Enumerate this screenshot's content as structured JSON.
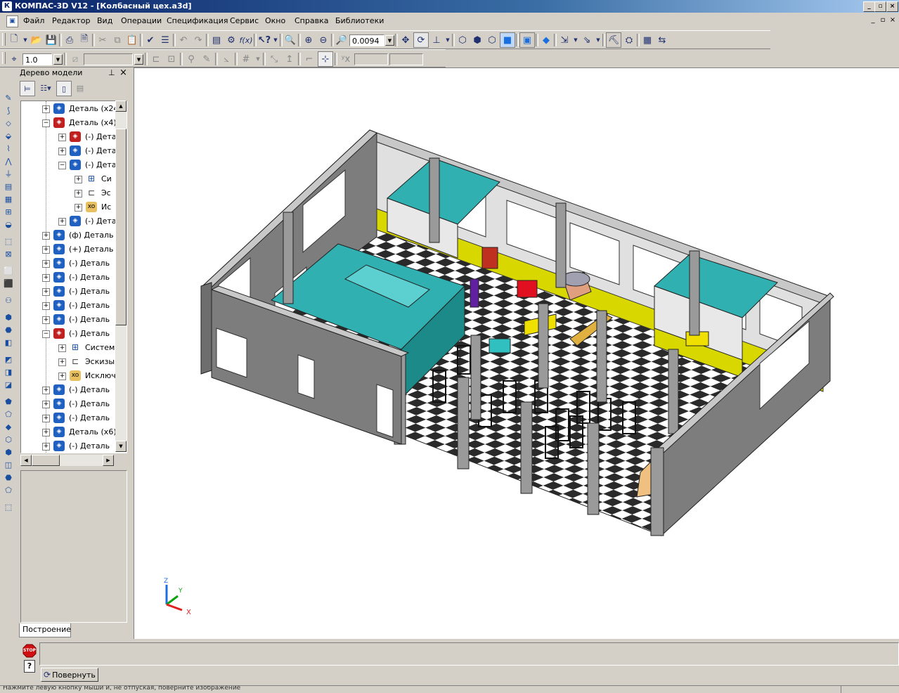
{
  "window": {
    "title": "КОМПАС-3D V12 - [Колбасный цех.a3d]",
    "app_icon": "kompas-logo-icon",
    "controls": [
      "_",
      "▫",
      "×"
    ]
  },
  "menu": {
    "items": [
      "Файл",
      "Редактор",
      "Вид",
      "Операции",
      "Спецификация",
      "Сервис",
      "Окно",
      "Справка",
      "Библиотеки"
    ],
    "mdi_controls": [
      "_",
      "▫",
      "×"
    ]
  },
  "toolbar": {
    "zoom_value": "0.0094",
    "step_value": "1.0",
    "fx_label": "f(x)"
  },
  "tree": {
    "header": "Дерево модели",
    "pin": "⊥",
    "close": "×",
    "rows": [
      {
        "indent": 0,
        "exp": "+",
        "icon": "blue",
        "label": "Деталь (x24"
      },
      {
        "indent": 0,
        "exp": "−",
        "icon": "red",
        "label": "Деталь (x4)"
      },
      {
        "indent": 1,
        "exp": "+",
        "icon": "red",
        "label": "(-) Дета"
      },
      {
        "indent": 1,
        "exp": "+",
        "icon": "blue",
        "label": "(-) Дета"
      },
      {
        "indent": 1,
        "exp": "−",
        "icon": "blue",
        "label": "(-) Дета"
      },
      {
        "indent": 2,
        "exp": "+",
        "icon": "sys",
        "label": "Си"
      },
      {
        "indent": 2,
        "exp": "+",
        "icon": "sketch",
        "label": "Эс"
      },
      {
        "indent": 2,
        "exp": "+",
        "icon": "xo",
        "label": "Ис"
      },
      {
        "indent": 1,
        "exp": "+",
        "icon": "blue",
        "label": "(-) Дета"
      },
      {
        "indent": 0,
        "exp": "+",
        "icon": "blue",
        "label": "(ф) Деталь"
      },
      {
        "indent": 0,
        "exp": "+",
        "icon": "blue",
        "label": "(+) Деталь"
      },
      {
        "indent": 0,
        "exp": "+",
        "icon": "blue",
        "label": "(-) Деталь"
      },
      {
        "indent": 0,
        "exp": "+",
        "icon": "blue",
        "label": "(-) Деталь"
      },
      {
        "indent": 0,
        "exp": "+",
        "icon": "blue",
        "label": "(-) Деталь"
      },
      {
        "indent": 0,
        "exp": "+",
        "icon": "blue",
        "label": "(-) Деталь"
      },
      {
        "indent": 0,
        "exp": "+",
        "icon": "blue",
        "label": "(-) Деталь"
      },
      {
        "indent": 0,
        "exp": "−",
        "icon": "red",
        "label": "(-) Деталь"
      },
      {
        "indent": 1,
        "exp": "+",
        "icon": "sys",
        "label": "Систем"
      },
      {
        "indent": 1,
        "exp": "+",
        "icon": "sketch",
        "label": "Эскизы"
      },
      {
        "indent": 1,
        "exp": "+",
        "icon": "xo",
        "label": "Исключ"
      },
      {
        "indent": 0,
        "exp": "+",
        "icon": "blue",
        "label": "(-) Деталь"
      },
      {
        "indent": 0,
        "exp": "+",
        "icon": "blue",
        "label": "(-) Деталь"
      },
      {
        "indent": 0,
        "exp": "+",
        "icon": "blue",
        "label": "(-) Деталь"
      },
      {
        "indent": 0,
        "exp": "+",
        "icon": "blue",
        "label": "Деталь (x6)"
      },
      {
        "indent": 0,
        "exp": "+",
        "icon": "blue",
        "label": "(-) Деталь"
      }
    ],
    "tab_label": "Построение"
  },
  "viewport": {
    "axis_labels": {
      "x": "X",
      "y": "Y",
      "z": "Z"
    }
  },
  "command": {
    "stop_label": "STOP",
    "help_label": "?",
    "rotate_button": "Повернуть"
  },
  "status": {
    "hint": "Нажмите левую кнопку мыши и, не отпуская, поверните изображение"
  },
  "colors": {
    "title_start": "#0a246a",
    "title_end": "#a6caf0",
    "wall": "#7d7d7d",
    "wall_top": "#c8c8c8",
    "yellow": "#d8d800",
    "teal": "#30b0b0",
    "floor_dark": "#333333"
  }
}
